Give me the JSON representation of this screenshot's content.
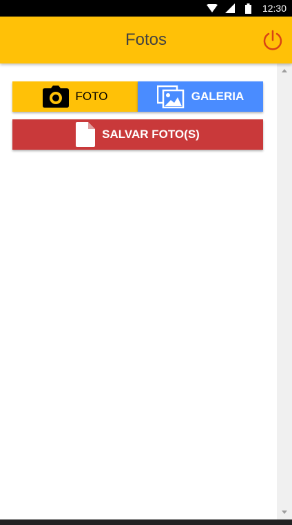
{
  "status_bar": {
    "time": "12:30",
    "icons": [
      "wifi-icon",
      "signal-icon",
      "battery-icon"
    ]
  },
  "app_bar": {
    "title": "Fotos",
    "action_icon": "power-icon",
    "background": "#FFC107",
    "title_color": "#424242",
    "action_color": "#D84315"
  },
  "buttons": {
    "foto": {
      "label": "FOTO",
      "icon": "camera-icon",
      "background": "#FFC107"
    },
    "galeria": {
      "label": "GALERIA",
      "icon": "images-icon",
      "background": "#4A8CFF"
    },
    "salvar": {
      "label": "SALVAR FOTO(S)",
      "icon": "file-icon",
      "background": "#C9393A"
    }
  }
}
